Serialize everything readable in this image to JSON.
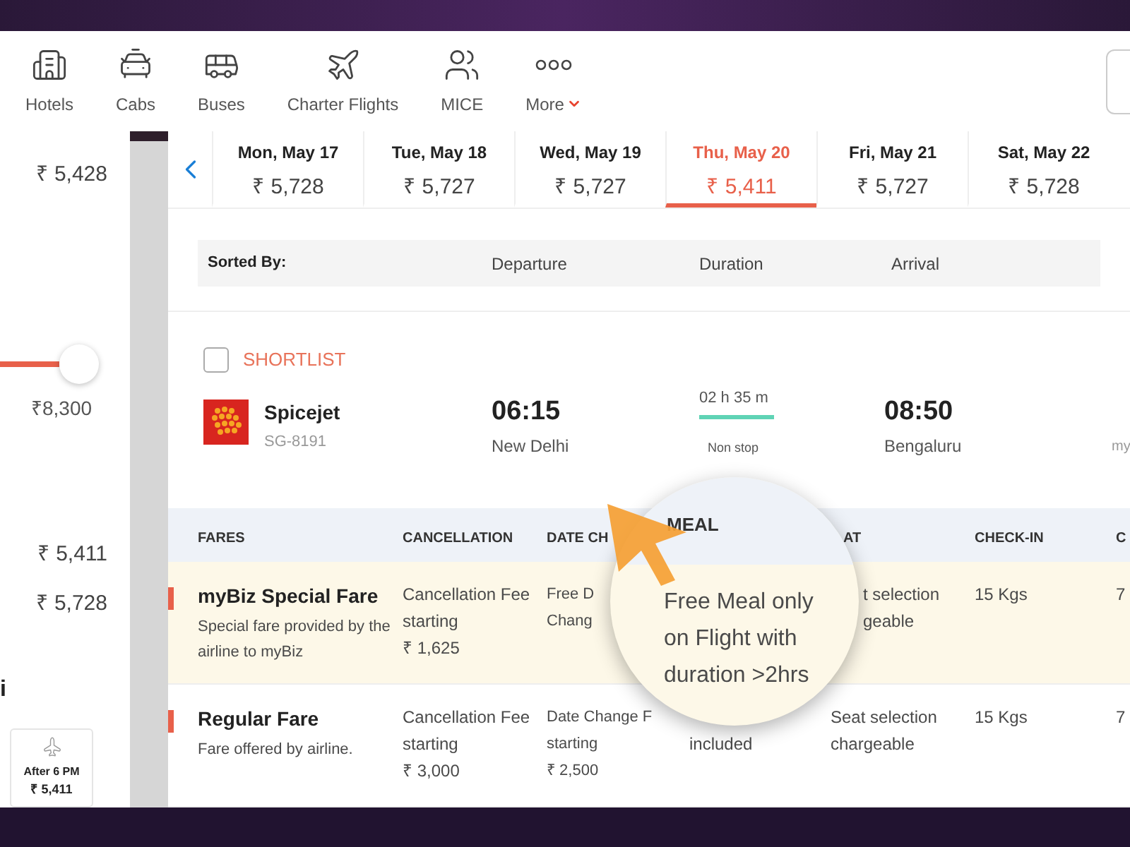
{
  "nav": {
    "items": [
      {
        "label": "Hotels"
      },
      {
        "label": "Cabs"
      },
      {
        "label": "Buses"
      },
      {
        "label": "Charter Flights"
      },
      {
        "label": "MICE"
      },
      {
        "label": "More",
        "dropdown": true
      }
    ]
  },
  "sidebar": {
    "price_top": "₹ 5,428",
    "slider": {
      "reading": "₹8,300"
    },
    "prices": [
      "₹ 5,411",
      "₹ 5,728"
    ],
    "cut_text": "i",
    "time_card": {
      "label": "After 6 PM",
      "price": "₹ 5,411"
    }
  },
  "dates": [
    {
      "day": "Mon, May 17",
      "price": "₹ 5,728",
      "selected": false
    },
    {
      "day": "Tue, May 18",
      "price": "₹ 5,727",
      "selected": false
    },
    {
      "day": "Wed, May 19",
      "price": "₹ 5,727",
      "selected": false
    },
    {
      "day": "Thu, May 20",
      "price": "₹ 5,411",
      "selected": true
    },
    {
      "day": "Fri, May 21",
      "price": "₹ 5,727",
      "selected": false
    },
    {
      "day": "Sat, May 22",
      "price": "₹ 5,728",
      "selected": false
    }
  ],
  "sort_bar": {
    "label": "Sorted By:",
    "options": [
      "Departure",
      "Duration",
      "Arrival"
    ]
  },
  "flight": {
    "shortlist": {
      "label": "SHORTLIST",
      "checked": false
    },
    "airline": "Spicejet",
    "code": "SG-8191",
    "departure": {
      "time": "06:15",
      "city": "New Delhi"
    },
    "duration": "02 h 35 m",
    "stops": "Non stop",
    "arrival": {
      "time": "08:50",
      "city": "Bengaluru"
    },
    "column_5": "my"
  },
  "fares": {
    "columns": [
      "FARES",
      "CANCELLATION",
      "DATE CH",
      "AT",
      "CHECK-IN",
      "C"
    ],
    "rows": [
      {
        "name": "myBiz Special Fare",
        "description": "Special fare provided by the airline to myBiz",
        "highlighted": true,
        "cancellation": [
          "Cancellation Fee",
          "starting",
          "₹ 1,625"
        ],
        "date_change": [
          "Free D",
          "Chang"
        ],
        "seat": [
          "t selection",
          "geable"
        ],
        "check_in": "15 Kgs",
        "column_6": "7"
      },
      {
        "name": "Regular Fare",
        "description": "Fare offered by airline.",
        "highlighted": false,
        "cancellation": [
          "Cancellation Fee",
          "starting",
          "₹ 3,000"
        ],
        "date_change": [
          "Date Change F",
          "starting",
          "₹ 2,500"
        ],
        "meal": [
          "included"
        ],
        "seat": [
          "Seat selection",
          "chargeable"
        ],
        "check_in": "15 Kgs",
        "column_6": "7"
      }
    ]
  },
  "magnifier": {
    "header": "MEAL",
    "text": "Free Meal only on Flight with duration >2hrs"
  }
}
